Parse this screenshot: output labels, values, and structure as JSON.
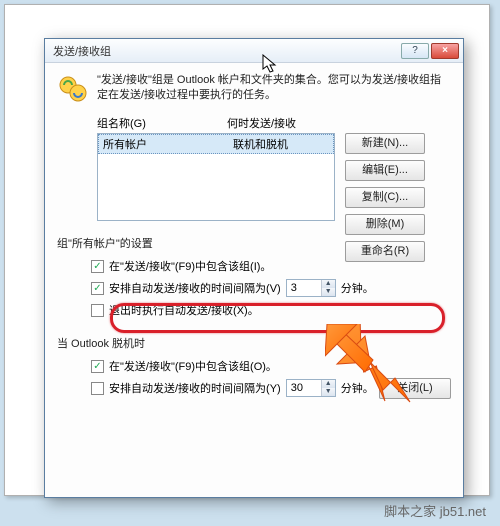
{
  "dialog": {
    "title": "发送/接收组",
    "intro": "\"发送/接收\"组是 Outlook 帐户和文件夹的集合。您可以为发送/接收组指定在发送/接收过程中要执行的任务。",
    "list": {
      "header_name": "组名称(G)",
      "header_when": "何时发送/接收",
      "row_name": "所有帐户",
      "row_when": "联机和脱机"
    },
    "buttons": {
      "new": "新建(N)...",
      "edit": "编辑(E)...",
      "copy": "复制(C)...",
      "remove": "删除(M)",
      "rename": "重命名(R)"
    },
    "group_settings_title": "组\"所有帐户\"的设置",
    "opt1": {
      "include_f9": "在\"发送/接收\"(F9)中包含该组(I)。",
      "schedule_label": "安排自动发送/接收的时间间隔为(V)",
      "schedule_value": "3",
      "minutes_suffix": "分钟。",
      "exit_label": "退出时执行自动发送/接收(X)。"
    },
    "offline_title": "当 Outlook 脱机时",
    "opt2": {
      "include_f9": "在\"发送/接收\"(F9)中包含该组(O)。",
      "schedule_label": "安排自动发送/接收的时间间隔为(Y)",
      "schedule_value": "30",
      "minutes_suffix": "分钟。"
    },
    "close": "关闭(L)"
  },
  "watermark": "脚本之家 jb51.net"
}
